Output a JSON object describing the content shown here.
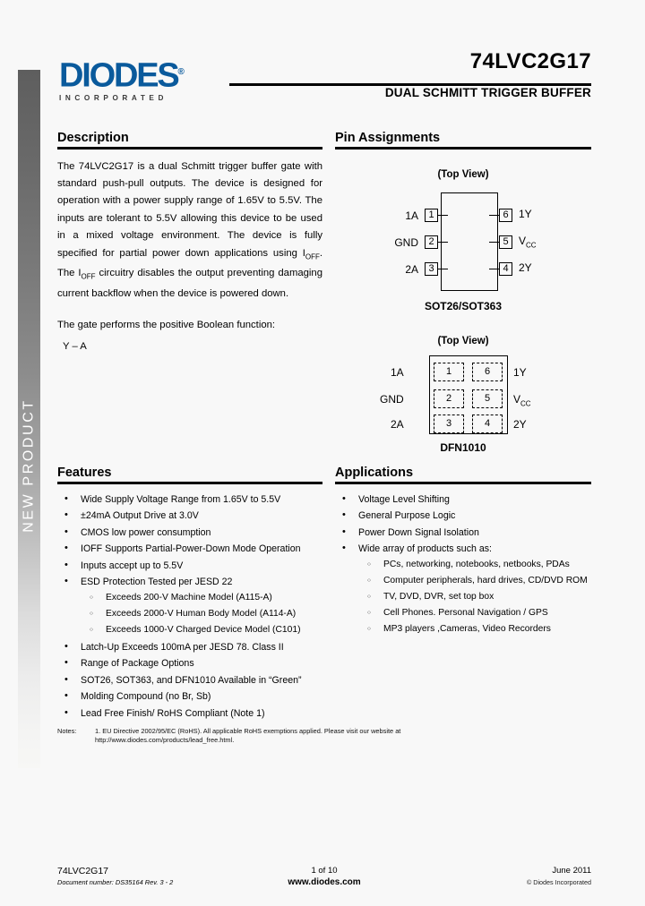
{
  "header": {
    "logo_word": "DIODES",
    "logo_registered": "®",
    "logo_sub": "INCORPORATED",
    "part_number": "74LVC2G17",
    "subtitle": "DUAL SCHMITT TRIGGER  BUFFER"
  },
  "sidebar": {
    "label": "NEW PRODUCT"
  },
  "description": {
    "title": "Description",
    "paragraph_1_a": "The 74LVC2G17 is a dual Schmitt trigger buffer gate with standard push-pull outputs.  The device is designed for operation with a power supply range of 1.65V to 5.5V.  The inputs are tolerant to 5.5V allowing this device to be used in a mixed voltage environment.  The device is fully specified for partial power down applications using I",
    "sub_off_1": "OFF",
    "paragraph_1_b": ".  The I",
    "sub_off_2": "OFF",
    "paragraph_1_c": " circuitry disables the output preventing damaging current backflow when the device is powered down.",
    "paragraph_2": "The gate performs the positive Boolean function:",
    "boolean_function": "Y – A"
  },
  "pin_assignments": {
    "title": "Pin Assignments",
    "sot": {
      "top_view": "(Top View)",
      "package": "SOT26/SOT363",
      "left_pins": [
        {
          "name": "1A",
          "number": "1"
        },
        {
          "name": "GND",
          "number": "2"
        },
        {
          "name": "2A",
          "number": "3"
        }
      ],
      "right_pins": [
        {
          "name": "1Y",
          "number": "6",
          "sub": ""
        },
        {
          "name": "V",
          "number": "5",
          "sub": "CC"
        },
        {
          "name": "2Y",
          "number": "4",
          "sub": ""
        }
      ]
    },
    "dfn": {
      "top_view": "(Top View)",
      "package": "DFN1010",
      "left_pins": [
        {
          "name": "1A",
          "number": "1"
        },
        {
          "name": "GND",
          "number": "2"
        },
        {
          "name": "2A",
          "number": "3"
        }
      ],
      "right_pins": [
        {
          "name": "1Y",
          "number": "6",
          "sub": ""
        },
        {
          "name": "V",
          "number": "5",
          "sub": "CC"
        },
        {
          "name": "2Y",
          "number": "4",
          "sub": ""
        }
      ]
    }
  },
  "features": {
    "title": "Features",
    "items": [
      {
        "text": "Wide Supply Voltage Range from 1.65V to 5.5V"
      },
      {
        "text": "±24mA Output Drive at 3.0V"
      },
      {
        "text": "CMOS low power consumption"
      },
      {
        "text": "IOFF Supports Partial-Power-Down Mode Operation"
      },
      {
        "text": "Inputs accept up to 5.5V"
      },
      {
        "text": "ESD Protection Tested per JESD 22",
        "sub": [
          "Exceeds 200-V Machine Model (A115-A)",
          "Exceeds 2000-V Human Body Model (A114-A)",
          "Exceeds 1000-V Charged Device Model (C101)"
        ]
      },
      {
        "text": "Latch-Up Exceeds 100mA per JESD 78. Class II"
      },
      {
        "text": "Range of Package Options"
      },
      {
        "text": "SOT26, SOT363, and DFN1010  Available in “Green”"
      },
      {
        "text": "Molding Compound (no Br, Sb)",
        "continuation": true
      },
      {
        "text": "Lead Free Finish/ RoHS Compliant (Note 1)"
      }
    ]
  },
  "applications": {
    "title": "Applications",
    "items": [
      {
        "text": "Voltage Level Shifting"
      },
      {
        "text": "General Purpose Logic"
      },
      {
        "text": "Power Down Signal Isolation"
      },
      {
        "text": "Wide array of products such as:",
        "sub": [
          "PCs, networking, notebooks, netbooks, PDAs",
          "Computer peripherals, hard drives, CD/DVD ROM",
          "TV, DVD, DVR, set top box",
          "Cell Phones. Personal Navigation / GPS",
          "MP3 players ,Cameras, Video Recorders"
        ]
      }
    ]
  },
  "notes": {
    "label": "Notes:",
    "text": "1. EU Directive 2002/95/EC (RoHS). All applicable RoHS exemptions applied. Please visit our website at http://www.diodes.com/products/lead_free.html."
  },
  "footer": {
    "left_line1": "74LVC2G17",
    "left_line2": "Document number: DS35164 Rev. 3 - 2",
    "center_line1": "1 of 10",
    "center_line2": "www.diodes.com",
    "right_line1": "June 2011",
    "right_line2": "© Diodes Incorporated"
  }
}
